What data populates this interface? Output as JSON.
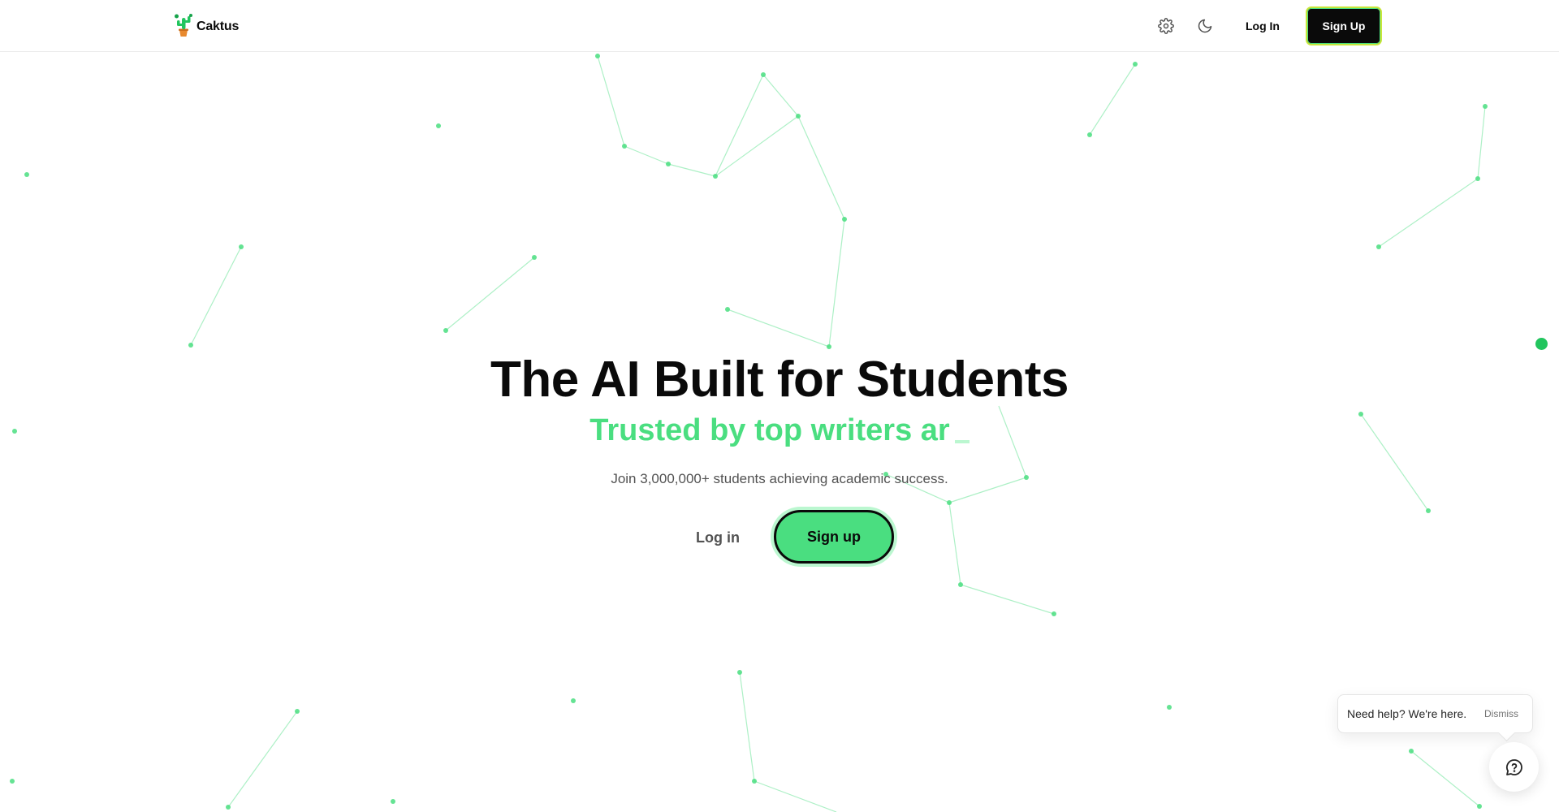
{
  "brand": {
    "name": "Caktus",
    "logo_icon": "cactus-logo-icon"
  },
  "header": {
    "settings_icon": "gear-icon",
    "theme_icon": "moon-icon",
    "login_label": "Log In",
    "signup_label": "Sign Up"
  },
  "hero": {
    "title": "The AI Built for Students",
    "subtitle_typed": "Trusted by top writers ar",
    "note": "Join 3,000,000+ students achieving academic success.",
    "login_label": "Log in",
    "signup_label": "Sign up"
  },
  "help": {
    "text": "Need help? We're here.",
    "dismiss_label": "Dismiss",
    "chat_icon": "chat-help-icon"
  },
  "colors": {
    "accent": "#4ade80",
    "accent_dark": "#22c55e",
    "text": "#0a0a0a",
    "muted": "#525252"
  }
}
